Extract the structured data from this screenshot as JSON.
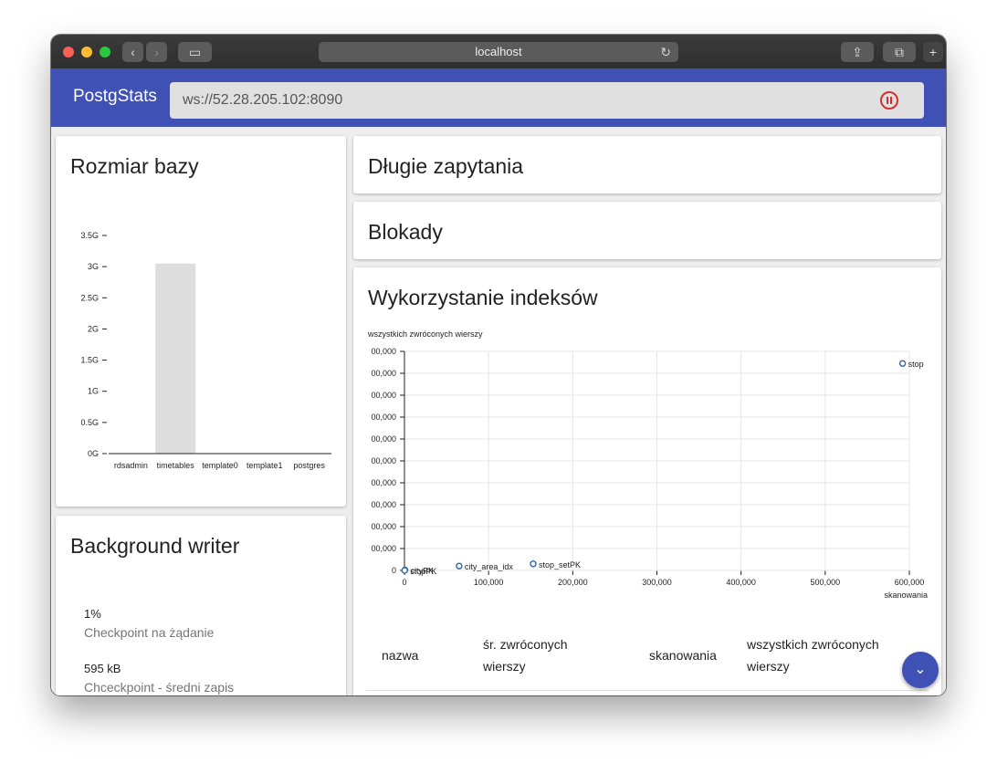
{
  "browser": {
    "url": "localhost",
    "reload_icon": "↻",
    "back_icon": "‹",
    "forward_icon": "›",
    "sidebar_icon": "▭",
    "share_icon": "⇪",
    "tabs_icon": "⧉",
    "new_tab_icon": "+"
  },
  "app": {
    "brand": "PostgStats",
    "ws_address": "ws://52.28.205.102:8090",
    "accent_color": "#3f51b5",
    "pause_color": "#d32f2f"
  },
  "db_size": {
    "title": "Rozmiar bazy",
    "chart_data": {
      "type": "bar",
      "categories": [
        "rdsadmin",
        "timetables",
        "template0",
        "template1",
        "postgres"
      ],
      "values": [
        0.005,
        3.05,
        0.007,
        0.007,
        0.007
      ],
      "yticks": [
        "0G",
        "0.5G",
        "1G",
        "1.5G",
        "2G",
        "2.5G",
        "3G",
        "3.5G"
      ],
      "ylim": [
        0,
        3.5
      ],
      "unit": "G"
    }
  },
  "long_queries": {
    "title": "Długie zapytania"
  },
  "locks": {
    "title": "Blokady"
  },
  "index_usage": {
    "title": "Wykorzystanie indeksów",
    "chart_data": {
      "type": "scatter",
      "ylabel": "wszystkich zwróconych wierszy",
      "xlabel": "skanowania",
      "xticks": [
        "0",
        "100,000",
        "200,000",
        "300,000",
        "400,000",
        "500,000",
        "600,000"
      ],
      "yticks": [
        "0",
        "00,000",
        "00,000",
        "00,000",
        "00,000",
        "00,000",
        "00,000",
        "00,000",
        "00,000",
        "00,000",
        "00,000"
      ],
      "xlim": [
        0,
        600000
      ],
      "ylim": [
        0,
        10
      ],
      "points": [
        {
          "label": "stop",
          "x": 592000,
          "y": 9.45
        },
        {
          "label": "stop_setPK",
          "x": 153000,
          "y": 0.3
        },
        {
          "label": "city_area_idx",
          "x": 65000,
          "y": 0.2
        },
        {
          "label": "cityPK",
          "x": 600,
          "y": 0.02
        },
        {
          "label": "stopPK",
          "x": 300,
          "y": 0.0
        }
      ]
    },
    "table": {
      "headers": [
        "nazwa",
        "śr. zwróconych wierszy",
        "skanowania",
        "wszystkich zwróconych wierszy"
      ]
    }
  },
  "bgwriter": {
    "title": "Background writer",
    "stats": [
      {
        "value": "1%",
        "label": "Checkpoint na żądanie"
      },
      {
        "value": "595 kB",
        "label": "Chceckpoint - średni zapis"
      }
    ]
  },
  "fab_icon": "⌄"
}
